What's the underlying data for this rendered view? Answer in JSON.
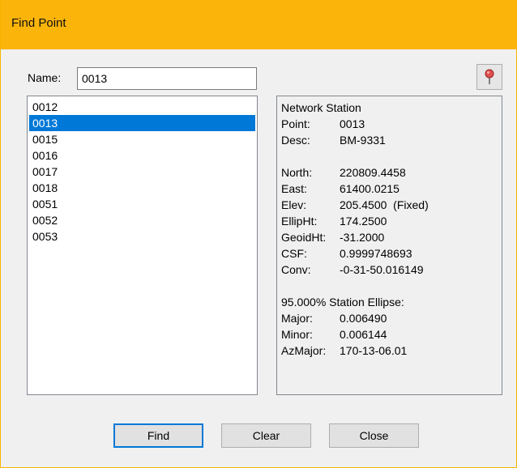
{
  "window": {
    "title": "Find Point"
  },
  "name_field": {
    "label": "Name:",
    "value": "0013"
  },
  "point_list": {
    "items": [
      "0012",
      "0013",
      "0015",
      "0016",
      "0017",
      "0018",
      "0051",
      "0052",
      "0053"
    ],
    "selected": "0013"
  },
  "details": {
    "heading": "Network Station",
    "rows": [
      {
        "label": "Point:",
        "value": "0013"
      },
      {
        "label": "Desc:",
        "value": "BM-9331"
      },
      {
        "label": "North:",
        "value": "220809.4458"
      },
      {
        "label": "East:",
        "value": "61400.0215"
      },
      {
        "label": "Elev:",
        "value": "205.4500  (Fixed)"
      },
      {
        "label": "EllipHt:",
        "value": "174.2500"
      },
      {
        "label": "GeoidHt:",
        "value": "-31.2000"
      },
      {
        "label": "CSF:",
        "value": "0.9999748693"
      },
      {
        "label": "Conv:",
        "value": "-0-31-50.016149"
      },
      {
        "label": "95.000% Station Ellipse:",
        "value": ""
      },
      {
        "label": "Major:",
        "value": "0.006490"
      },
      {
        "label": "Minor:",
        "value": "0.006144"
      },
      {
        "label": "AzMajor:",
        "value": "170-13-06.01"
      }
    ]
  },
  "buttons": {
    "find": "Find",
    "clear": "Clear",
    "close": "Close"
  },
  "icons": {
    "locate": "map-pin-icon"
  },
  "colors": {
    "titlebar": "#fbb40a",
    "selection": "#0078d7",
    "pin": "#e05050"
  }
}
